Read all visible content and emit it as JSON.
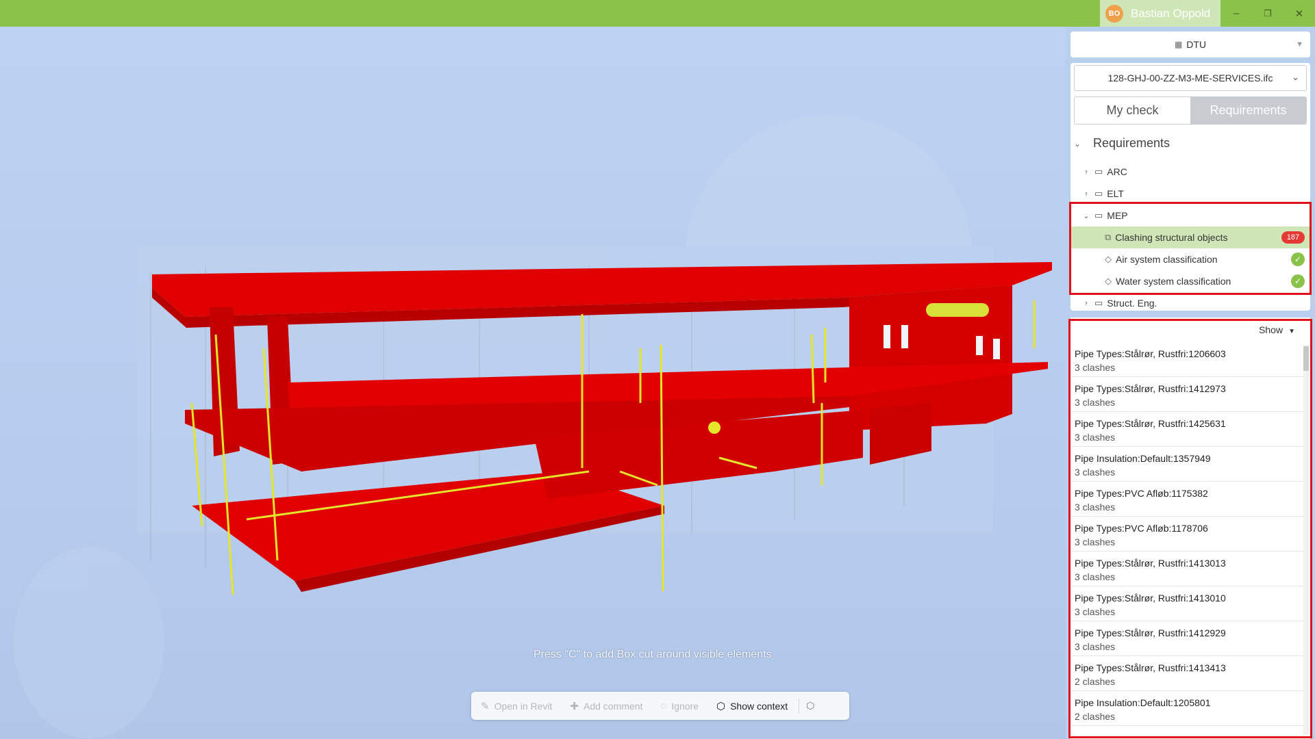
{
  "titlebar": {
    "user_initials": "BO",
    "user_name": "Bastian Oppold",
    "controls": {
      "minimize": "–",
      "restore": "❐",
      "close": "✕"
    }
  },
  "viewport": {
    "hint": "Press \"C\" to add Box cut around visible elements",
    "toolbar": {
      "open_in_revit": "Open in Revit",
      "add_comment": "Add comment",
      "ignore": "Ignore",
      "show_context": "Show context"
    }
  },
  "panel": {
    "workspace": "DTU",
    "file": "128-GHJ-00-ZZ-M3-ME-SERVICES.ifc",
    "tabs": [
      "My check",
      "Requirements"
    ],
    "active_tab": "Requirements",
    "tree": {
      "root": "Requirements",
      "folders": [
        "ARC",
        "ELT",
        "MEP",
        "Struct. Eng."
      ],
      "mep_items": [
        {
          "label": "Clashing structural objects",
          "badge": "187",
          "status": "error"
        },
        {
          "label": "Air system classification",
          "badge": "✓",
          "status": "ok"
        },
        {
          "label": "Water system classification",
          "badge": "✓",
          "status": "ok"
        }
      ]
    },
    "results": {
      "show_label": "Show",
      "items": [
        {
          "name": "Pipe Types:Stålrør, Rustfri:1206603",
          "count": "3 clashes"
        },
        {
          "name": "Pipe Types:Stålrør, Rustfri:1412973",
          "count": "3 clashes"
        },
        {
          "name": "Pipe Types:Stålrør, Rustfri:1425631",
          "count": "3 clashes"
        },
        {
          "name": "Pipe Insulation:Default:1357949",
          "count": "3 clashes"
        },
        {
          "name": "Pipe Types:PVC Afløb:1175382",
          "count": "3 clashes"
        },
        {
          "name": "Pipe Types:PVC Afløb:1178706",
          "count": "3 clashes"
        },
        {
          "name": "Pipe Types:Stålrør, Rustfri:1413013",
          "count": "3 clashes"
        },
        {
          "name": "Pipe Types:Stålrør, Rustfri:1413010",
          "count": "3 clashes"
        },
        {
          "name": "Pipe Types:Stålrør, Rustfri:1412929",
          "count": "3 clashes"
        },
        {
          "name": "Pipe Types:Stålrør, Rustfri:1413413",
          "count": "2 clashes"
        },
        {
          "name": "Pipe Insulation:Default:1205801",
          "count": "2 clashes"
        }
      ]
    }
  },
  "colors": {
    "titlebar": "#8bc34a",
    "highlight": "#cfe6b6",
    "model_red": "#e30000",
    "pipes_yellow": "#e5e52a",
    "annotation_box": "#e0111b",
    "badge_error": "#e53935",
    "badge_ok": "#8bc34a"
  }
}
